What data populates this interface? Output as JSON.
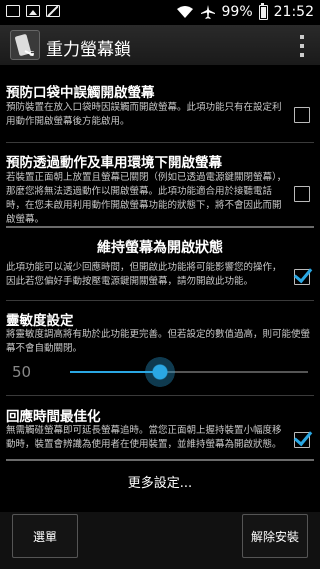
{
  "status_bar": {
    "battery_percent": "99%",
    "time": "21:52",
    "icons": [
      "notification-box-icon",
      "image-icon",
      "no-sim-icon",
      "wifi-icon",
      "airplane-icon",
      "battery-icon"
    ]
  },
  "action_bar": {
    "title": "重力螢幕鎖",
    "overflow_icon": "overflow-menu-icon"
  },
  "settings": {
    "pocket": {
      "title": "預防口袋中誤觸開啟螢幕",
      "summary": "預防裝置在放入口袋時因誤觸而開啟螢幕。此項功能只有在設定利用動作開啟螢幕後方能啟用。",
      "checked": false
    },
    "motion": {
      "title": "預防透過動作及車用環境下開啟螢幕",
      "summary": "若裝置正面朝上放置且螢幕已關閉（例如已透過電源鍵關閉螢幕），那麼您將無法透過動作以開啟螢幕。此項功能適合用於接聽電話時，在您未啟用利用動作開啟螢幕功能的狀態下，將不會因此而開啟螢幕。",
      "checked": false
    },
    "keep_on_category": "維持螢幕為開啟狀態",
    "keep_on": {
      "summary": "此項功能可以減少回應時間，但開啟此功能將可能影響您的操作，因此若您偏好手動按壓電源鍵開關螢幕，請勿開啟此功能。",
      "checked": true
    },
    "sensitivity": {
      "title": "靈敏度設定",
      "summary": "將靈敏度調高將有助於此功能更完善。但若設定的數值過高，則可能使螢幕不會自動關閉。",
      "value": "50",
      "fraction": 0.38
    },
    "response": {
      "title": "回應時間最佳化",
      "summary": "無需觸碰螢幕即可延長螢幕追時。當您正面朝上握持裝置小幅度移動時，裝置會辨識為使用者在使用裝置，並維持螢幕為開啟狀態。",
      "checked": true
    },
    "more_label": "更多設定..."
  },
  "buttons": {
    "menu_label": "選單",
    "uninstall_label": "解除安裝"
  },
  "colors": {
    "accent": "#2aa7e3",
    "background": "#000000"
  }
}
